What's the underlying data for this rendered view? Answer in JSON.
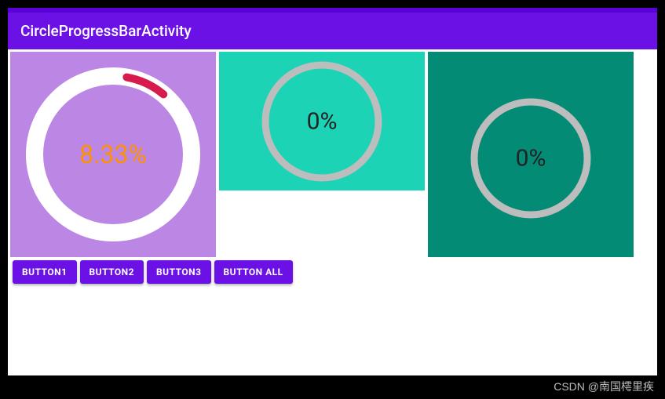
{
  "app_bar": {
    "title": "CircleProgressBarActivity"
  },
  "colors": {
    "primary": "#6b11e5",
    "card1_bg": "#bb86e4",
    "card2_bg": "#1cd3b6",
    "card3_bg": "#038b76",
    "ring_bg_white": "#ffffff",
    "ring_bg_grey": "#bdbdbd",
    "progress_red": "#d81b4d",
    "text_orange": "#ff9100"
  },
  "progress": {
    "p1": {
      "value": 8.33,
      "label": "8.33%"
    },
    "p2": {
      "value": 0,
      "label": "0%"
    },
    "p3": {
      "value": 0,
      "label": "0%"
    }
  },
  "buttons": [
    {
      "label": "BUTTON1"
    },
    {
      "label": "BUTTON2"
    },
    {
      "label": "BUTTON3"
    },
    {
      "label": "BUTTON ALL"
    }
  ],
  "watermark": "CSDN @南国樗里疾"
}
